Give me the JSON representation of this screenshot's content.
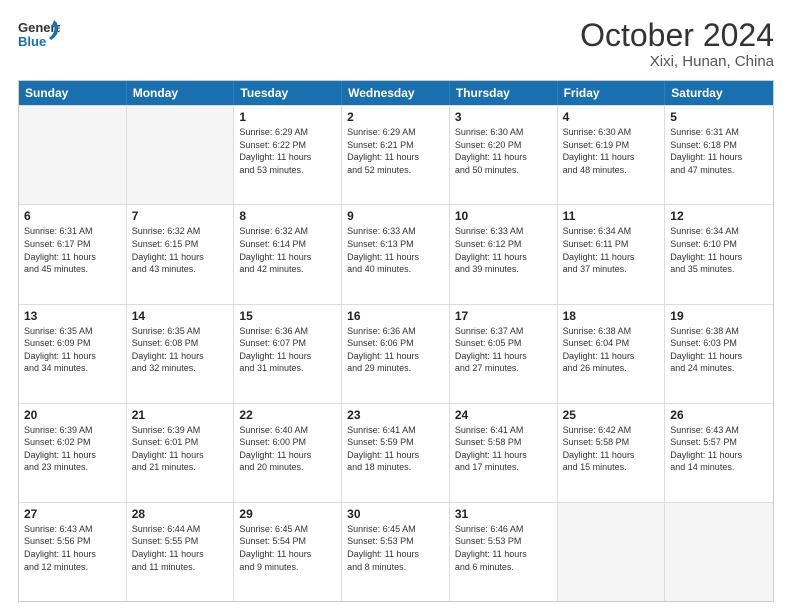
{
  "header": {
    "logo_general": "General",
    "logo_blue": "Blue",
    "main_title": "October 2024",
    "subtitle": "Xixi, Hunan, China"
  },
  "calendar": {
    "weekdays": [
      "Sunday",
      "Monday",
      "Tuesday",
      "Wednesday",
      "Thursday",
      "Friday",
      "Saturday"
    ],
    "weeks": [
      [
        {
          "day": "",
          "info": "",
          "empty": true
        },
        {
          "day": "",
          "info": "",
          "empty": true
        },
        {
          "day": "1",
          "info": "Sunrise: 6:29 AM\nSunset: 6:22 PM\nDaylight: 11 hours\nand 53 minutes.",
          "empty": false
        },
        {
          "day": "2",
          "info": "Sunrise: 6:29 AM\nSunset: 6:21 PM\nDaylight: 11 hours\nand 52 minutes.",
          "empty": false
        },
        {
          "day": "3",
          "info": "Sunrise: 6:30 AM\nSunset: 6:20 PM\nDaylight: 11 hours\nand 50 minutes.",
          "empty": false
        },
        {
          "day": "4",
          "info": "Sunrise: 6:30 AM\nSunset: 6:19 PM\nDaylight: 11 hours\nand 48 minutes.",
          "empty": false
        },
        {
          "day": "5",
          "info": "Sunrise: 6:31 AM\nSunset: 6:18 PM\nDaylight: 11 hours\nand 47 minutes.",
          "empty": false
        }
      ],
      [
        {
          "day": "6",
          "info": "Sunrise: 6:31 AM\nSunset: 6:17 PM\nDaylight: 11 hours\nand 45 minutes.",
          "empty": false
        },
        {
          "day": "7",
          "info": "Sunrise: 6:32 AM\nSunset: 6:15 PM\nDaylight: 11 hours\nand 43 minutes.",
          "empty": false
        },
        {
          "day": "8",
          "info": "Sunrise: 6:32 AM\nSunset: 6:14 PM\nDaylight: 11 hours\nand 42 minutes.",
          "empty": false
        },
        {
          "day": "9",
          "info": "Sunrise: 6:33 AM\nSunset: 6:13 PM\nDaylight: 11 hours\nand 40 minutes.",
          "empty": false
        },
        {
          "day": "10",
          "info": "Sunrise: 6:33 AM\nSunset: 6:12 PM\nDaylight: 11 hours\nand 39 minutes.",
          "empty": false
        },
        {
          "day": "11",
          "info": "Sunrise: 6:34 AM\nSunset: 6:11 PM\nDaylight: 11 hours\nand 37 minutes.",
          "empty": false
        },
        {
          "day": "12",
          "info": "Sunrise: 6:34 AM\nSunset: 6:10 PM\nDaylight: 11 hours\nand 35 minutes.",
          "empty": false
        }
      ],
      [
        {
          "day": "13",
          "info": "Sunrise: 6:35 AM\nSunset: 6:09 PM\nDaylight: 11 hours\nand 34 minutes.",
          "empty": false
        },
        {
          "day": "14",
          "info": "Sunrise: 6:35 AM\nSunset: 6:08 PM\nDaylight: 11 hours\nand 32 minutes.",
          "empty": false
        },
        {
          "day": "15",
          "info": "Sunrise: 6:36 AM\nSunset: 6:07 PM\nDaylight: 11 hours\nand 31 minutes.",
          "empty": false
        },
        {
          "day": "16",
          "info": "Sunrise: 6:36 AM\nSunset: 6:06 PM\nDaylight: 11 hours\nand 29 minutes.",
          "empty": false
        },
        {
          "day": "17",
          "info": "Sunrise: 6:37 AM\nSunset: 6:05 PM\nDaylight: 11 hours\nand 27 minutes.",
          "empty": false
        },
        {
          "day": "18",
          "info": "Sunrise: 6:38 AM\nSunset: 6:04 PM\nDaylight: 11 hours\nand 26 minutes.",
          "empty": false
        },
        {
          "day": "19",
          "info": "Sunrise: 6:38 AM\nSunset: 6:03 PM\nDaylight: 11 hours\nand 24 minutes.",
          "empty": false
        }
      ],
      [
        {
          "day": "20",
          "info": "Sunrise: 6:39 AM\nSunset: 6:02 PM\nDaylight: 11 hours\nand 23 minutes.",
          "empty": false
        },
        {
          "day": "21",
          "info": "Sunrise: 6:39 AM\nSunset: 6:01 PM\nDaylight: 11 hours\nand 21 minutes.",
          "empty": false
        },
        {
          "day": "22",
          "info": "Sunrise: 6:40 AM\nSunset: 6:00 PM\nDaylight: 11 hours\nand 20 minutes.",
          "empty": false
        },
        {
          "day": "23",
          "info": "Sunrise: 6:41 AM\nSunset: 5:59 PM\nDaylight: 11 hours\nand 18 minutes.",
          "empty": false
        },
        {
          "day": "24",
          "info": "Sunrise: 6:41 AM\nSunset: 5:58 PM\nDaylight: 11 hours\nand 17 minutes.",
          "empty": false
        },
        {
          "day": "25",
          "info": "Sunrise: 6:42 AM\nSunset: 5:58 PM\nDaylight: 11 hours\nand 15 minutes.",
          "empty": false
        },
        {
          "day": "26",
          "info": "Sunrise: 6:43 AM\nSunset: 5:57 PM\nDaylight: 11 hours\nand 14 minutes.",
          "empty": false
        }
      ],
      [
        {
          "day": "27",
          "info": "Sunrise: 6:43 AM\nSunset: 5:56 PM\nDaylight: 11 hours\nand 12 minutes.",
          "empty": false
        },
        {
          "day": "28",
          "info": "Sunrise: 6:44 AM\nSunset: 5:55 PM\nDaylight: 11 hours\nand 11 minutes.",
          "empty": false
        },
        {
          "day": "29",
          "info": "Sunrise: 6:45 AM\nSunset: 5:54 PM\nDaylight: 11 hours\nand 9 minutes.",
          "empty": false
        },
        {
          "day": "30",
          "info": "Sunrise: 6:45 AM\nSunset: 5:53 PM\nDaylight: 11 hours\nand 8 minutes.",
          "empty": false
        },
        {
          "day": "31",
          "info": "Sunrise: 6:46 AM\nSunset: 5:53 PM\nDaylight: 11 hours\nand 6 minutes.",
          "empty": false
        },
        {
          "day": "",
          "info": "",
          "empty": true
        },
        {
          "day": "",
          "info": "",
          "empty": true
        }
      ]
    ]
  }
}
